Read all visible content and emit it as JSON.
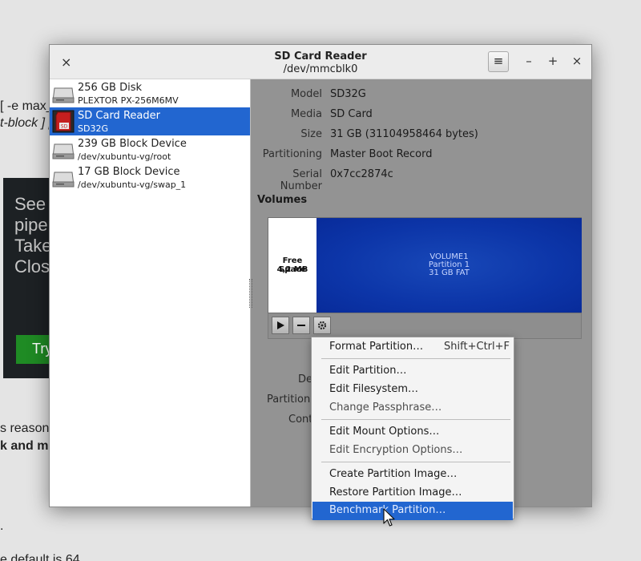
{
  "background_page": {
    "fragments": [
      "[ -e max_",
      "t-block ] [",
      "s reason",
      "k and ml",
      ".",
      "e default is 64"
    ],
    "dark_box_lines": [
      "See",
      "pipe",
      "Take",
      "Clos"
    ],
    "try_button": "Try"
  },
  "window": {
    "title": "SD Card Reader",
    "subtitle": "/dev/mmcblk0",
    "menu_glyph": "≡",
    "controls": {
      "close_left": "×",
      "minimize": "–",
      "maximize": "+",
      "close": "×"
    }
  },
  "devices": [
    {
      "name": "256 GB Disk",
      "sub": "PLEXTOR PX-256M6MV",
      "icon": "hard-disk-icon"
    },
    {
      "name": "SD Card Reader",
      "sub": "SD32G",
      "icon": "sd-card-icon"
    },
    {
      "name": "239 GB Block Device",
      "sub": "/dev/xubuntu-vg/root",
      "icon": "hard-disk-icon"
    },
    {
      "name": "17 GB Block Device",
      "sub": "/dev/xubuntu-vg/swap_1",
      "icon": "hard-disk-icon"
    }
  ],
  "drive_info": [
    {
      "label": "Model",
      "value": "SD32G"
    },
    {
      "label": "Media",
      "value": "SD Card"
    },
    {
      "label": "Size",
      "value": "31 GB (31104958464 bytes)"
    },
    {
      "label": "Partitioning",
      "value": "Master Boot Record"
    },
    {
      "label": "Serial Number",
      "value": "0x7cc2874c"
    }
  ],
  "volumes": {
    "heading": "Volumes",
    "free_space": {
      "label": "Free Space",
      "size": "4,2 MB"
    },
    "partition": {
      "name": "VOLUME1",
      "number": "Partition 1",
      "desc": "31 GB FAT"
    }
  },
  "partially_hidden_labels": [
    "De",
    "Partition T",
    "Conte"
  ],
  "context_menu": {
    "items": [
      {
        "label": "Format Partition…",
        "accel": "Shift+Ctrl+F"
      },
      {
        "label": "Edit Partition…"
      },
      {
        "label": "Edit Filesystem…"
      },
      {
        "label": "Change Passphrase…"
      },
      {
        "label": "Edit Mount Options…"
      },
      {
        "label": "Edit Encryption Options…"
      },
      {
        "label": "Create Partition Image…"
      },
      {
        "label": "Restore Partition Image…"
      },
      {
        "label": "Benchmark Partition…"
      }
    ]
  },
  "colors": {
    "selection": "#2266d0",
    "partition_fill": "#0c35a8",
    "right_pane_dim": "#939393"
  }
}
